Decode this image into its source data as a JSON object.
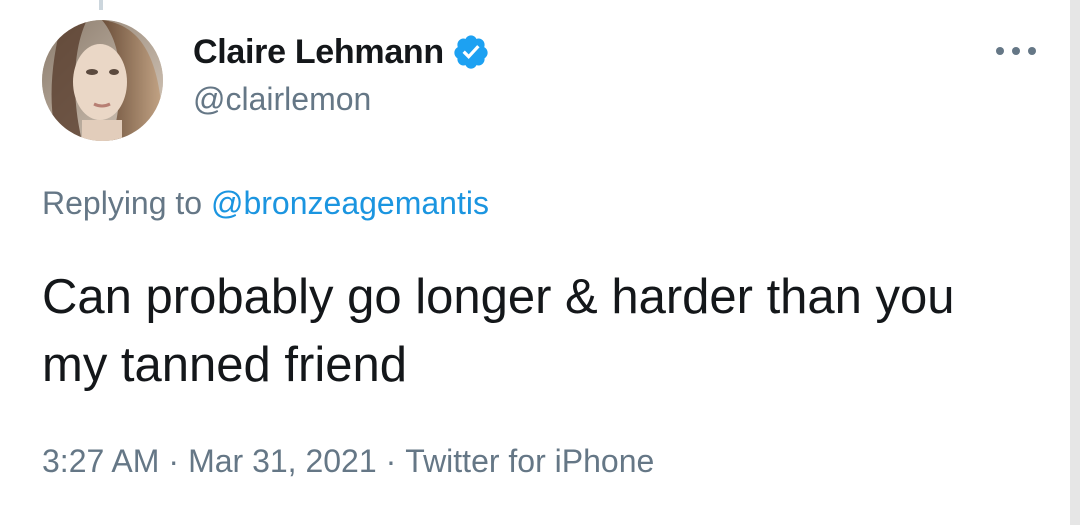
{
  "author": {
    "display_name": "Claire Lehmann",
    "handle": "@clairlemon",
    "verified": true
  },
  "reply": {
    "prefix": "Replying to",
    "mention": "@bronzeagemantis"
  },
  "tweet": {
    "text": "Can probably go longer & harder than you my tanned friend"
  },
  "meta": {
    "time": "3:27 AM",
    "separator": "·",
    "date": "Mar 31, 2021",
    "source": "Twitter for iPhone"
  },
  "colors": {
    "text_primary": "#14171a",
    "text_secondary": "#657786",
    "accent": "#1b95e0",
    "verified_badge": "#1da1f2"
  },
  "icons": {
    "verified": "verified-badge-icon",
    "more": "more-options-icon"
  }
}
